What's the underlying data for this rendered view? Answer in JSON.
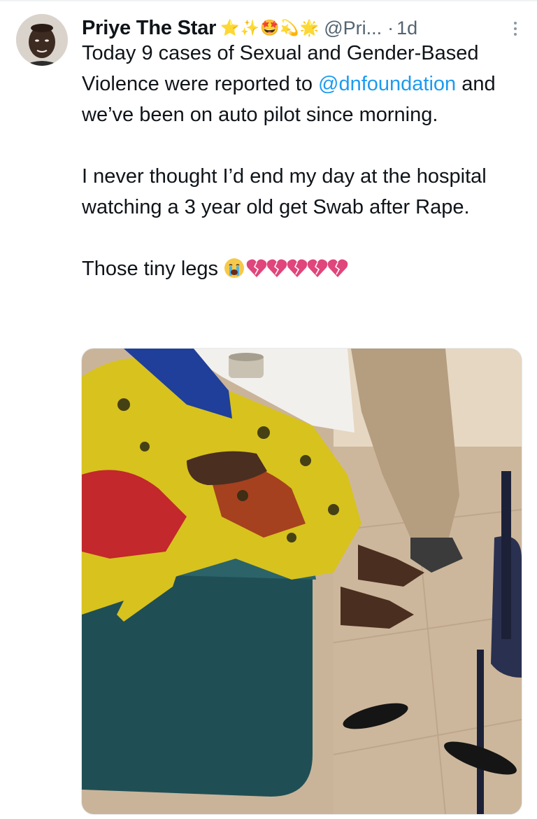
{
  "tweet": {
    "author_name": "Priye The Star",
    "name_emojis": "⭐✨🤩💫🌟",
    "handle": "@Pri...",
    "separator": "·",
    "time": "1d",
    "text": {
      "line1_prefix": "Today 9 cases of Sexual and Gender-Based Violence were reported to ",
      "mention": "@dnfoundation",
      "line1_suffix": " and we’ve been on auto pilot since morning.",
      "para2": "I never thought I’d end my day at the hospital watching a 3 year old get Swab after Rape.",
      "para3": "Those tiny legs"
    },
    "emojis_after_text": [
      "crying-face",
      "broken-heart",
      "broken-heart",
      "broken-heart",
      "broken-heart",
      "broken-heart"
    ],
    "colors": {
      "mention": "#1d9bf0",
      "secondary_text": "#536471",
      "broken_heart": "#e0457b",
      "bench": "#1f4f55",
      "fabric_yellow": "#d8c21e"
    }
  },
  "icons": {
    "more": "more-vertical-icon",
    "avatar": "avatar"
  }
}
